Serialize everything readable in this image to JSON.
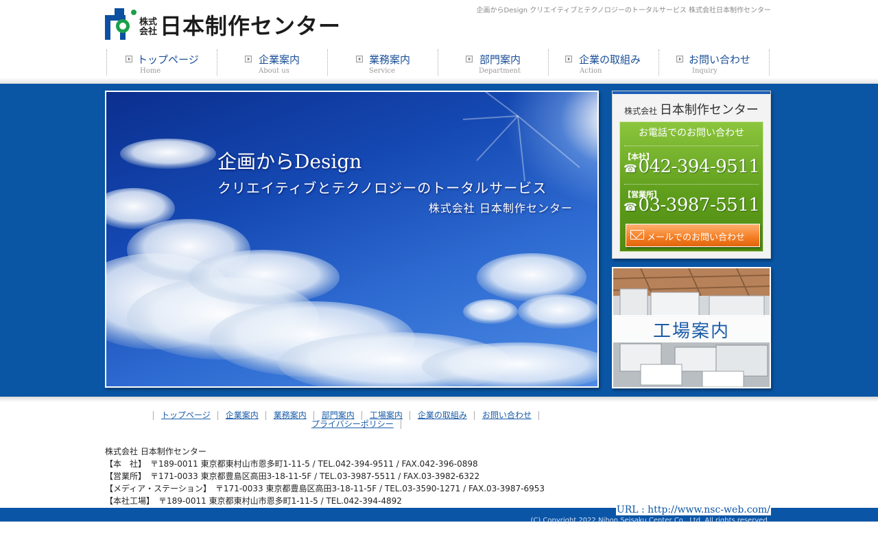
{
  "site": {
    "tagline": "企画からDesign クリエイティブとテクノロジーのトータルサービス 株式会社日本制作センター",
    "logo": {
      "small": "株式会社",
      "big": "日本制作センター"
    }
  },
  "nav": {
    "items": [
      {
        "label": "トップページ",
        "sub": "Home"
      },
      {
        "label": "企業案内",
        "sub": "About us"
      },
      {
        "label": "業務案内",
        "sub": "Service"
      },
      {
        "label": "部門案内",
        "sub": "Department"
      },
      {
        "label": "企業の取組み",
        "sub": "Action"
      },
      {
        "label": "お問い合わせ",
        "sub": "Inquiry"
      }
    ]
  },
  "hero": {
    "line1": "企画からDesign",
    "line2": "クリエイティブとテクノロジーのトータルサービス",
    "line3": "株式会社 日本制作センター"
  },
  "contact": {
    "company_prefix": "株式会社",
    "company_name": "日本制作センター",
    "title": "お電話でのお問い合わせ",
    "head_office_label": "【本社】",
    "head_office_tel": "042-394-9511",
    "sales_office_label": "【営業所】",
    "sales_office_tel": "03-3987-5511",
    "mail_button": "メールでのお問い合わせ"
  },
  "factory": {
    "label": "工場案内"
  },
  "footer": {
    "links_row1": [
      "トップページ",
      "企業案内",
      "業務案内",
      "部門案内",
      "工場案内",
      "企業の取組み",
      "お問い合わせ"
    ],
    "links_row2": [
      "プライバシーポリシー"
    ],
    "company": "株式会社 日本制作センター",
    "addresses": [
      "【本　社】　〒189-0011 東京都東村山市恩多町1-11-5 / TEL.042-394-9511 / FAX.042-396-0898",
      "【営業所】　〒171-0033 東京都豊島区高田3-18-11-5F / TEL.03-3987-5511 / FAX.03-3982-6322",
      "【メディア・ステーション】　〒171-0033 東京都豊島区高田3-18-11-5F / TEL.03-3590-1271 / FAX.03-3987-6953",
      "【本社工場】　〒189-0011 東京都東村山市恩多町1-11-5 / TEL.042-394-4892"
    ],
    "url": "URL : http://www.nsc-web.com/",
    "copyright": "(C) Copyright 2022 Nihon Seisaku Center Co., Ltd. All rights reserved."
  },
  "colors": {
    "brand_blue": "#0a56a5",
    "contact_green": "#5f9e1c",
    "mail_orange": "#f47d22",
    "link_blue": "#1a5ca8"
  },
  "icons": [
    "logo-mark-icon",
    "nav-arrow-icon",
    "phone-icon",
    "mail-icon"
  ]
}
